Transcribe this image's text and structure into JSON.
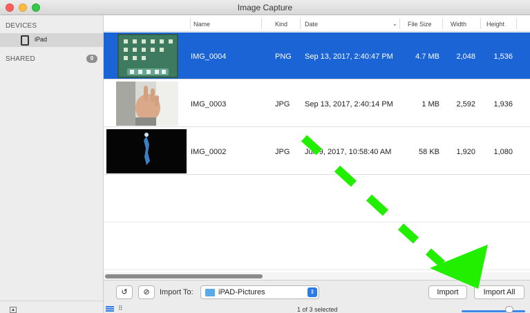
{
  "window": {
    "title": "Image Capture"
  },
  "sidebar": {
    "devices_header": "DEVICES",
    "device_item": {
      "label": "iPad",
      "icon": "ipad-icon"
    },
    "shared_header": "SHARED",
    "shared_count": "0"
  },
  "table": {
    "columns": [
      "Name",
      "Kind",
      "Date",
      "File Size",
      "Width",
      "Height"
    ],
    "rows": [
      {
        "name": "IMG_0004",
        "kind": "PNG",
        "date": "Sep 13, 2017, 2:40:47 PM",
        "size": "4.7 MB",
        "width": "2,048",
        "height": "1,536",
        "selected": true
      },
      {
        "name": "IMG_0003",
        "kind": "JPG",
        "date": "Sep 13, 2017, 2:40:14 PM",
        "size": "1 MB",
        "width": "2,592",
        "height": "1,936",
        "selected": false
      },
      {
        "name": "IMG_0002",
        "kind": "JPG",
        "date": "Jun 9, 2017, 10:58:40 AM",
        "size": "58 KB",
        "width": "1,920",
        "height": "1,080",
        "selected": false
      }
    ]
  },
  "bottombar": {
    "import_to_label": "Import To:",
    "folder": "iPAD-Pictures",
    "import_button": "Import",
    "import_all_button": "Import All",
    "status": "1 of 3 selected"
  },
  "colors": {
    "selection": "#1a64d6",
    "annotation_arrow": "#22ee00"
  }
}
